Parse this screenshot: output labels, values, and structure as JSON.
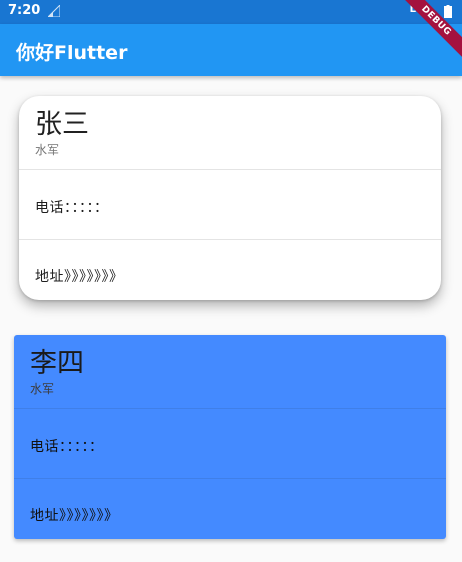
{
  "status_bar": {
    "time": "7:20",
    "network": "LTE",
    "icons": [
      "signal-icon",
      "battery-icon"
    ]
  },
  "app_bar": {
    "title": "你好Flutter",
    "debug_banner": "DEBUG"
  },
  "cards": [
    {
      "name": "张三",
      "subtitle": "水军",
      "phone": "电话：：：：：",
      "address": "地址》》》》》》》"
    },
    {
      "name": "李四",
      "subtitle": "水军",
      "phone": "电话：：：：：",
      "address": "地址》》》》》》》"
    }
  ],
  "colors": {
    "status_bar": "#1976d2",
    "app_bar": "#2196f3",
    "card_1": "#ffffff",
    "card_2": "#448aff",
    "debug_banner": "#a4123f"
  }
}
